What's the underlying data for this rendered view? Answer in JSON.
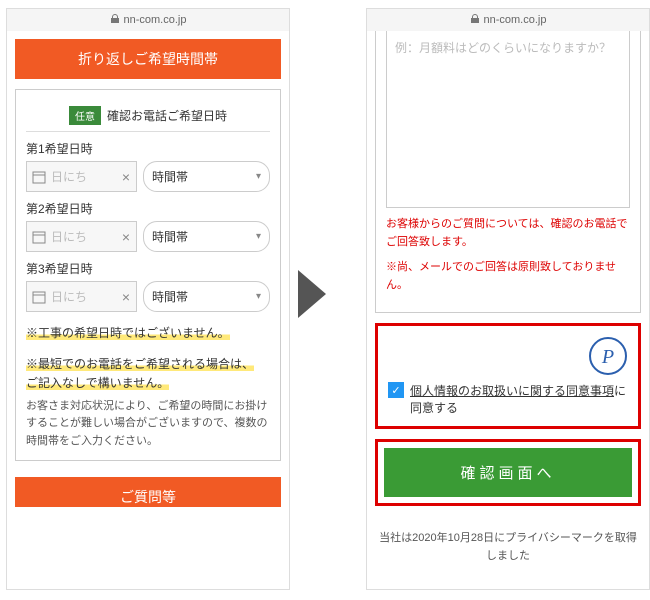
{
  "url": "nn-com.co.jp",
  "left": {
    "header1": "折り返しご希望時間帯",
    "badge": "任意",
    "badgeLabel": "確認お電話ご希望日時",
    "slots": [
      {
        "label": "第1希望日時",
        "date_ph": "日にち",
        "time_ph": "時間帯"
      },
      {
        "label": "第2希望日時",
        "date_ph": "日にち",
        "time_ph": "時間帯"
      },
      {
        "label": "第3希望日時",
        "date_ph": "日にち",
        "time_ph": "時間帯"
      }
    ],
    "note1": "※工事の希望日時ではございません。",
    "note2a": "※最短でのお電話をご希望される場合は、",
    "note2b": "ご記入なしで構いません。",
    "note2c": "お客さま対応状況により、ご希望の時間にお掛けすることが難しい場合がございますので、複数の時間帯をご入力ください。",
    "header2": "ご質問等"
  },
  "right": {
    "ta_ph": "例：月額料はどのくらいになりますか？",
    "red1": "お客様からのご質問については、確認のお電話でご回答致します。",
    "red2": "※尚、メールでのご回答は原則致しておりません。",
    "consent_link": "個人情報のお取扱いに関する同意事項",
    "consent_tail": "に同意する",
    "btn": "確認画面へ",
    "footer": "当社は2020年10月28日にプライバシーマークを取得しました"
  }
}
